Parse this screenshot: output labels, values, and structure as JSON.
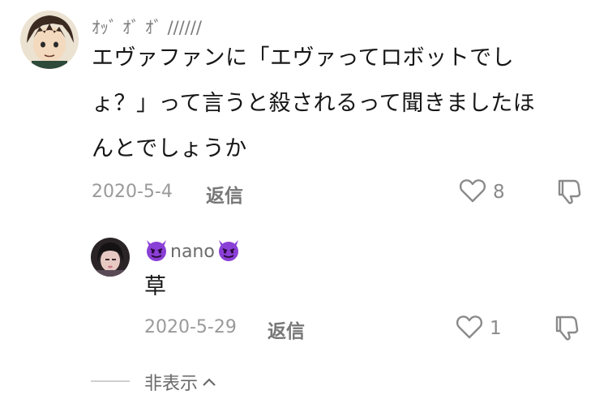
{
  "comment": {
    "username": "ｵｯﾞ ｵﾞ ｵﾞ //////",
    "text_lines": [
      "エヴァファンに「エヴァってロボットでし",
      "ょ？」って言うと殺されるって聞きましたほ",
      "んとでしょうか"
    ],
    "date": "2020-5-4",
    "reply_label": "返信",
    "like_count": "8",
    "icons": {
      "like": "heart-outline-icon",
      "dislike": "thumbs-down-icon"
    }
  },
  "reply": {
    "username": "nano",
    "username_emoji": "devil-face-emoji",
    "text": "草",
    "date": "2020-5-29",
    "reply_label": "返信",
    "like_count": "1",
    "icons": {
      "like": "heart-outline-icon",
      "dislike": "thumbs-down-icon"
    }
  },
  "hide_replies": {
    "label": "非表示",
    "icon": "chevron-up-icon"
  },
  "colors": {
    "text": "#161616",
    "meta": "#9a9a9a",
    "accent_purple": "#8a3fd6"
  }
}
